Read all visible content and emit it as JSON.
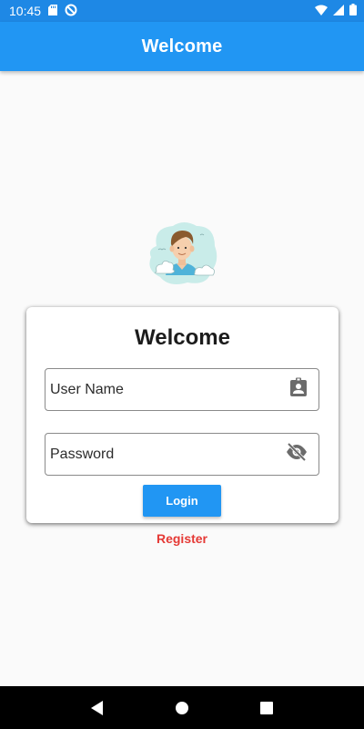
{
  "status_bar": {
    "time": "10:45",
    "icons": [
      "sd-card-icon",
      "sync-icon",
      "wifi-icon",
      "signal-icon",
      "battery-icon"
    ]
  },
  "app_bar": {
    "title": "Welcome"
  },
  "login_card": {
    "title": "Welcome",
    "username_placeholder": "User Name",
    "username_icon": "contact-badge-icon",
    "password_placeholder": "Password",
    "password_icon": "visibility-off-icon",
    "login_label": "Login"
  },
  "register_label": "Register",
  "nav_bar": {
    "icons": [
      "back-icon",
      "home-icon",
      "recents-icon"
    ]
  },
  "colors": {
    "primary": "#2196f3",
    "status_bar": "#1e88e5",
    "register": "#e53935",
    "background": "#fafafa"
  }
}
